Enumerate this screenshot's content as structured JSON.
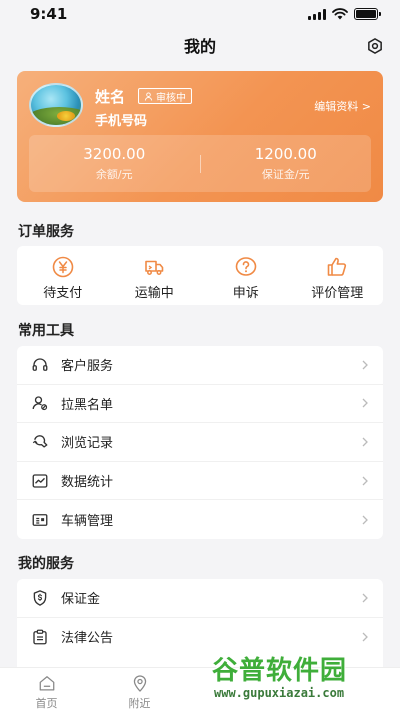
{
  "status_bar": {
    "time": "9:41"
  },
  "header": {
    "title": "我的"
  },
  "profile": {
    "name": "姓名",
    "badge": "审核中",
    "phone": "手机号码",
    "edit_label": "编辑资料 >",
    "balance_value": "3200.00",
    "balance_label": "余额/元",
    "deposit_value": "1200.00",
    "deposit_label": "保证金/元"
  },
  "order_services": {
    "title": "订单服务",
    "items": [
      {
        "label": "待支付",
        "icon": "yuan-coin-icon"
      },
      {
        "label": "运输中",
        "icon": "truck-icon"
      },
      {
        "label": "申诉",
        "icon": "question-icon"
      },
      {
        "label": "评价管理",
        "icon": "thumbs-up-icon"
      }
    ]
  },
  "tools": {
    "title": "常用工具",
    "items": [
      {
        "label": "客户服务",
        "icon": "headset-icon"
      },
      {
        "label": "拉黑名单",
        "icon": "user-block-icon"
      },
      {
        "label": "浏览记录",
        "icon": "history-icon"
      },
      {
        "label": "数据统计",
        "icon": "chart-icon"
      },
      {
        "label": "车辆管理",
        "icon": "vehicle-card-icon"
      }
    ]
  },
  "my_services": {
    "title": "我的服务",
    "items": [
      {
        "label": "保证金",
        "icon": "shield-dollar-icon"
      },
      {
        "label": "法律公告",
        "icon": "clipboard-icon"
      }
    ]
  },
  "tab_bar": {
    "items": [
      {
        "label": "首页",
        "icon": "home-icon"
      },
      {
        "label": "附近",
        "icon": "location-icon"
      }
    ]
  },
  "watermark": {
    "main": "谷普软件园",
    "url": "www.gupuxiazai.com"
  },
  "colors": {
    "accent": "#f39452",
    "background": "#f4f4f6"
  }
}
